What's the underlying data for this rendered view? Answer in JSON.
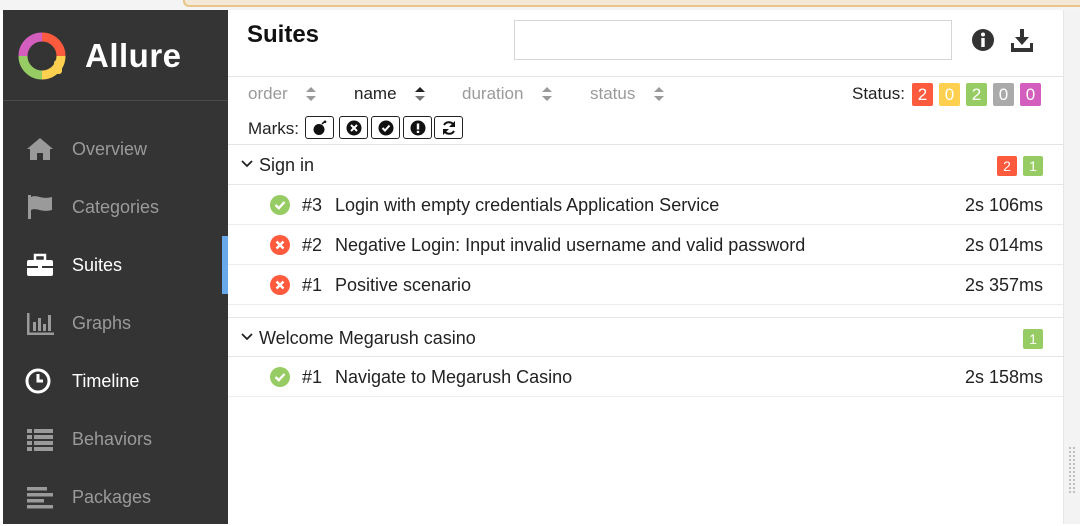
{
  "app": {
    "name": "Allure"
  },
  "sidebar": {
    "items": [
      {
        "label": "Overview",
        "icon": "home-icon"
      },
      {
        "label": "Categories",
        "icon": "flag-icon"
      },
      {
        "label": "Suites",
        "icon": "briefcase-icon",
        "active": true
      },
      {
        "label": "Graphs",
        "icon": "bar-chart-icon"
      },
      {
        "label": "Timeline",
        "icon": "clock-icon"
      },
      {
        "label": "Behaviors",
        "icon": "list-icon"
      },
      {
        "label": "Packages",
        "icon": "align-left-icon"
      }
    ]
  },
  "main": {
    "title": "Suites",
    "search": {
      "value": "",
      "placeholder": ""
    },
    "sort": {
      "order": "order",
      "name": "name",
      "duration": "duration",
      "status": "status"
    },
    "status_label": "Status:",
    "status_badges": [
      {
        "value": "2",
        "color": "#fd5a3e"
      },
      {
        "value": "0",
        "color": "#ffd050"
      },
      {
        "value": "2",
        "color": "#97cc64"
      },
      {
        "value": "0",
        "color": "#aaaaaa"
      },
      {
        "value": "0",
        "color": "#d35ebe"
      }
    ],
    "marks_label": "Marks:",
    "marks": [
      "bomb-icon",
      "x-circle-icon",
      "check-circle-icon",
      "exclamation-circle-icon",
      "refresh-icon"
    ],
    "groups": [
      {
        "title": "Sign in",
        "badges": [
          {
            "value": "2",
            "color": "#fd5a3e"
          },
          {
            "value": "1",
            "color": "#97cc64"
          }
        ],
        "rows": [
          {
            "status": "passed",
            "num": "#3",
            "name": "Login with empty credentials Application Service",
            "duration": "2s 106ms"
          },
          {
            "status": "failed",
            "num": "#2",
            "name": "Negative Login: Input invalid username and valid password",
            "duration": "2s 014ms"
          },
          {
            "status": "failed",
            "num": "#1",
            "name": "Positive scenario",
            "duration": "2s 357ms"
          }
        ]
      },
      {
        "title": "Welcome Megarush casino",
        "badges": [
          {
            "value": "1",
            "color": "#97cc64"
          }
        ],
        "rows": [
          {
            "status": "passed",
            "num": "#1",
            "name": "Navigate to Megarush Casino",
            "duration": "2s 158ms"
          }
        ]
      }
    ]
  },
  "colors": {
    "passed": "#97cc64",
    "failed": "#fd5a3e",
    "sidebar_bg": "#343434",
    "active_indicator": "#6aa8ec"
  }
}
